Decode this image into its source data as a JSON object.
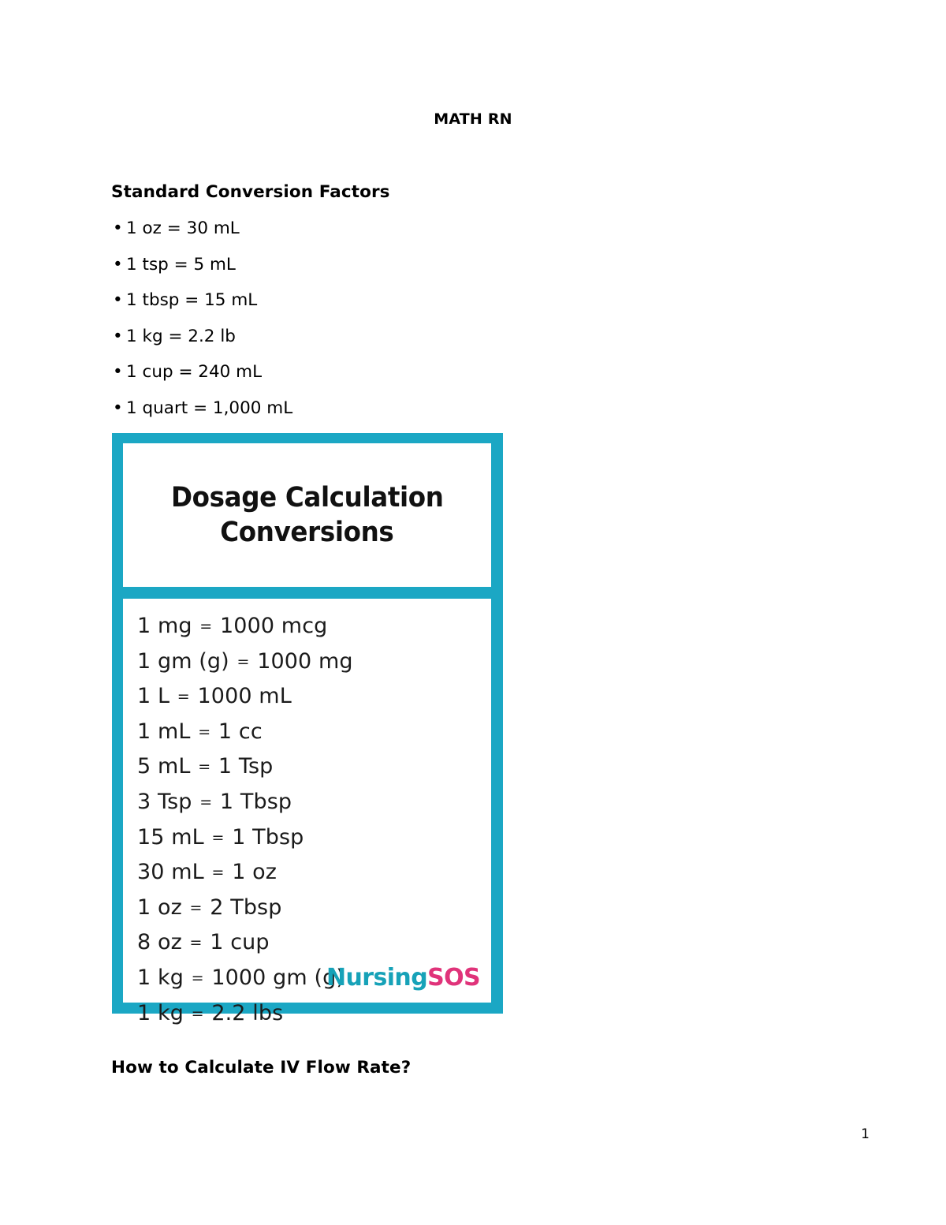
{
  "document": {
    "running_header": "MATH RN",
    "page_number": "1"
  },
  "sections": {
    "standard_conversions": {
      "heading": "Standard Conversion Factors",
      "bullet_glyph": "•",
      "items": [
        "1 oz = 30 mL",
        "1 tsp = 5 mL",
        "1 tbsp = 15 mL",
        "1 kg = 2.2 lb",
        "1 cup = 240 mL",
        "1 quart = 1,000 mL"
      ]
    },
    "iv_flow_rate": {
      "heading": "How to Calculate IV Flow Rate?"
    }
  },
  "conversion_card": {
    "title_line_1": "Dosage Calculation",
    "title_line_2": "Conversions",
    "rows": [
      {
        "left": "1 mg",
        "eq": "=",
        "right": "1000 mcg"
      },
      {
        "left": "1 gm (g)",
        "eq": "=",
        "right": "1000 mg"
      },
      {
        "left": "1 L",
        "eq": "=",
        "right": "1000 mL"
      },
      {
        "left": "1 mL",
        "eq": "=",
        "right": "1 cc"
      },
      {
        "left": "5 mL",
        "eq": "=",
        "right": "1 Tsp"
      },
      {
        "left": "3 Tsp",
        "eq": "=",
        "right": "1 Tbsp"
      },
      {
        "left": "15 mL",
        "eq": "=",
        "right": "1 Tbsp"
      },
      {
        "left": "30 mL",
        "eq": "=",
        "right": "1 oz"
      },
      {
        "left": "1 oz",
        "eq": "=",
        "right": "2 Tbsp"
      },
      {
        "left": "8 oz",
        "eq": "=",
        "right": "1 cup"
      },
      {
        "left": "1 kg",
        "eq": "=",
        "right": "1000 gm (g)"
      },
      {
        "left": "1 kg",
        "eq": "=",
        "right": "2.2 lbs"
      }
    ],
    "brand": {
      "part_1": "Nursing",
      "part_2": "SOS"
    },
    "colors": {
      "border_teal": "#1BA7C4",
      "brand_teal": "#17A2B8",
      "brand_pink": "#E0337A",
      "panel_background": "#FFFFFF"
    }
  }
}
